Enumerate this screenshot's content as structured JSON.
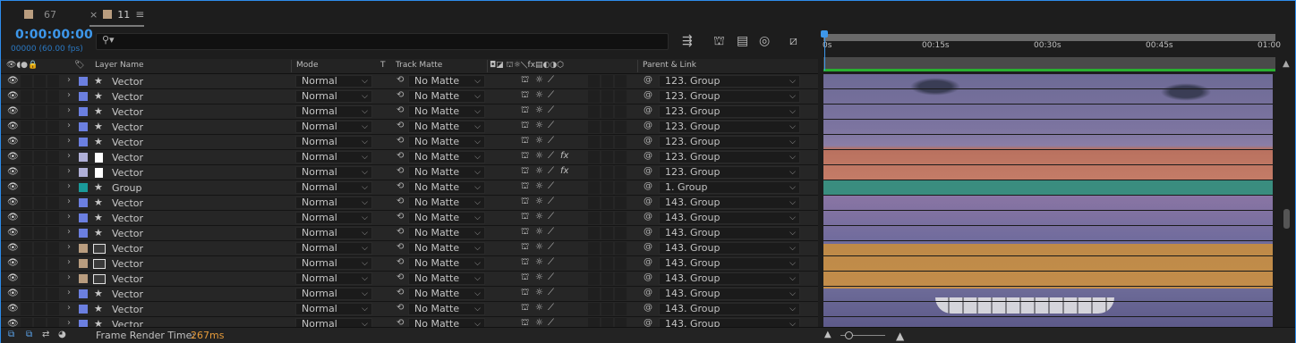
{
  "tabs": [
    {
      "label": "67",
      "color": "#b99d7f",
      "active": false
    },
    {
      "label": "11",
      "color": "#b99d7f",
      "active": true
    }
  ],
  "timecode": "0:00:00:00",
  "frame_info": "00000 (60.00 fps)",
  "search": {
    "placeholder": ""
  },
  "columns": {
    "layer_name": "Layer Name",
    "mode": "Mode",
    "t": "T",
    "track_matte": "Track Matte",
    "parent_link": "Parent & Link"
  },
  "timeline": {
    "ticks": [
      "0s",
      "00:15s",
      "00:30s",
      "00:45s",
      "01:00"
    ]
  },
  "layers": [
    {
      "name": "Vector",
      "label_color": "#6b7fe0",
      "icon": "star-icon",
      "mode": "Normal",
      "matte": "No Matte",
      "parent": "123. Group",
      "fx": false
    },
    {
      "name": "Vector",
      "label_color": "#6b7fe0",
      "icon": "star-icon",
      "mode": "Normal",
      "matte": "No Matte",
      "parent": "123. Group",
      "fx": false
    },
    {
      "name": "Vector",
      "label_color": "#6b7fe0",
      "icon": "star-icon",
      "mode": "Normal",
      "matte": "No Matte",
      "parent": "123. Group",
      "fx": false
    },
    {
      "name": "Vector",
      "label_color": "#6b7fe0",
      "icon": "star-icon",
      "mode": "Normal",
      "matte": "No Matte",
      "parent": "123. Group",
      "fx": false
    },
    {
      "name": "Vector",
      "label_color": "#6b7fe0",
      "icon": "star-icon",
      "mode": "Normal",
      "matte": "No Matte",
      "parent": "123. Group",
      "fx": false
    },
    {
      "name": "Vector",
      "label_color": "#b0b0d8",
      "icon": "file-icon",
      "mode": "Normal",
      "matte": "No Matte",
      "parent": "123. Group",
      "fx": true
    },
    {
      "name": "Vector",
      "label_color": "#b0b0d8",
      "icon": "file-icon",
      "mode": "Normal",
      "matte": "No Matte",
      "parent": "123. Group",
      "fx": true
    },
    {
      "name": "Group",
      "label_color": "#1a9a9a",
      "icon": "star-icon",
      "mode": "Normal",
      "matte": "No Matte",
      "parent": "1. Group",
      "fx": false
    },
    {
      "name": "Vector",
      "label_color": "#6b7fe0",
      "icon": "star-icon",
      "mode": "Normal",
      "matte": "No Matte",
      "parent": "143. Group",
      "fx": false
    },
    {
      "name": "Vector",
      "label_color": "#6b7fe0",
      "icon": "star-icon",
      "mode": "Normal",
      "matte": "No Matte",
      "parent": "143. Group",
      "fx": false
    },
    {
      "name": "Vector",
      "label_color": "#6b7fe0",
      "icon": "star-icon",
      "mode": "Normal",
      "matte": "No Matte",
      "parent": "143. Group",
      "fx": false
    },
    {
      "name": "Vector",
      "label_color": "#b99d7f",
      "icon": "comp-icon",
      "mode": "Normal",
      "matte": "No Matte",
      "parent": "143. Group",
      "fx": false
    },
    {
      "name": "Vector",
      "label_color": "#b99d7f",
      "icon": "comp-icon",
      "mode": "Normal",
      "matte": "No Matte",
      "parent": "143. Group",
      "fx": false
    },
    {
      "name": "Vector",
      "label_color": "#b99d7f",
      "icon": "comp-icon",
      "mode": "Normal",
      "matte": "No Matte",
      "parent": "143. Group",
      "fx": false
    },
    {
      "name": "Vector",
      "label_color": "#6b7fe0",
      "icon": "star-icon",
      "mode": "Normal",
      "matte": "No Matte",
      "parent": "143. Group",
      "fx": false
    },
    {
      "name": "Vector",
      "label_color": "#6b7fe0",
      "icon": "star-icon",
      "mode": "Normal",
      "matte": "No Matte",
      "parent": "143. Group",
      "fx": false
    },
    {
      "name": "Vector",
      "label_color": "#6b7fe0",
      "icon": "star-icon",
      "mode": "Normal",
      "matte": "No Matte",
      "parent": "143. Group",
      "fx": false
    }
  ],
  "status": {
    "label": "Frame Render Time:",
    "value": "267ms"
  }
}
